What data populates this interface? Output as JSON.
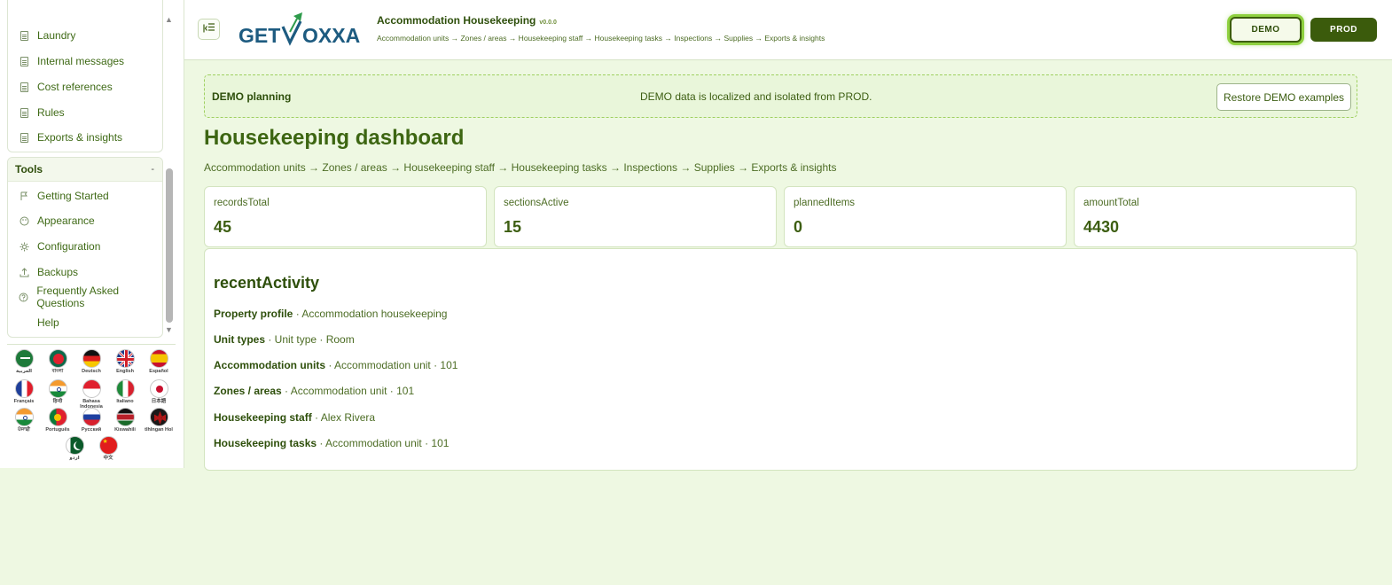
{
  "sidebar": {
    "nav_items": [
      {
        "label": "Laundry",
        "icon": "document-icon"
      },
      {
        "label": "Internal messages",
        "icon": "document-icon"
      },
      {
        "label": "Cost references",
        "icon": "document-icon"
      },
      {
        "label": "Rules",
        "icon": "document-icon"
      },
      {
        "label": "Exports & insights",
        "icon": "document-icon"
      }
    ],
    "tools": {
      "title": "Tools",
      "toggle": "-",
      "items": [
        {
          "label": "Getting Started",
          "icon": "flag-icon"
        },
        {
          "label": "Appearance",
          "icon": "palette-icon"
        },
        {
          "label": "Configuration",
          "icon": "gear-icon"
        },
        {
          "label": "Backups",
          "icon": "upload-icon"
        },
        {
          "label": "Frequently Asked Questions",
          "icon": "question-icon"
        },
        {
          "label": "Help",
          "icon": ""
        }
      ]
    },
    "languages": [
      {
        "label": "العربية"
      },
      {
        "label": "বাংলা"
      },
      {
        "label": "Deutsch"
      },
      {
        "label": "English"
      },
      {
        "label": "Español"
      },
      {
        "label": "Français"
      },
      {
        "label": "हिन्दी"
      },
      {
        "label": "Bahasa Indonesia"
      },
      {
        "label": "Italiano"
      },
      {
        "label": "日本語"
      },
      {
        "label": "ਪੰਜਾਬੀ"
      },
      {
        "label": "Português"
      },
      {
        "label": "Русский"
      },
      {
        "label": "Kiswahili"
      },
      {
        "label": "tlhIngan Hol"
      },
      {
        "label": "اردو"
      },
      {
        "label": "中文"
      }
    ]
  },
  "header": {
    "logo_text_left": "GET",
    "logo_text_right": "OXXA",
    "app_title": "Accommodation Housekeeping",
    "version": "v0.0.0",
    "crumbs": "Accommodation units → Zones / areas → Housekeeping staff → Housekeeping tasks → Inspections → Supplies → Exports & insights",
    "demo_button": "DEMO",
    "prod_button": "PROD"
  },
  "banner": {
    "title": "DEMO planning",
    "message": "DEMO data is localized and isolated from PROD.",
    "restore_button": "Restore DEMO examples"
  },
  "main": {
    "title": "Housekeeping dashboard",
    "crumbs": "Accommodation units → Zones / areas → Housekeeping staff → Housekeeping tasks → Inspections → Supplies → Exports & insights",
    "stats": [
      {
        "label": "recordsTotal",
        "value": "45"
      },
      {
        "label": "sectionsActive",
        "value": "15"
      },
      {
        "label": "plannedItems",
        "value": "0"
      },
      {
        "label": "amountTotal",
        "value": "4430"
      }
    ],
    "activity": {
      "title": "recentActivity",
      "rows": [
        {
          "name": "Property profile",
          "detail": " · Accommodation housekeeping"
        },
        {
          "name": "Unit types",
          "detail": " · Unit type · Room"
        },
        {
          "name": "Accommodation units",
          "detail": " · Accommodation unit · 101"
        },
        {
          "name": "Zones / areas",
          "detail": " · Accommodation unit · 101"
        },
        {
          "name": "Housekeeping staff",
          "detail": " · Alex Rivera"
        },
        {
          "name": "Housekeeping tasks",
          "detail": " · Accommodation unit · 101"
        }
      ]
    }
  },
  "colors": {
    "background": "#eef8e2",
    "primary": "#3b5b0c",
    "accent_glow": "#8fd140"
  }
}
